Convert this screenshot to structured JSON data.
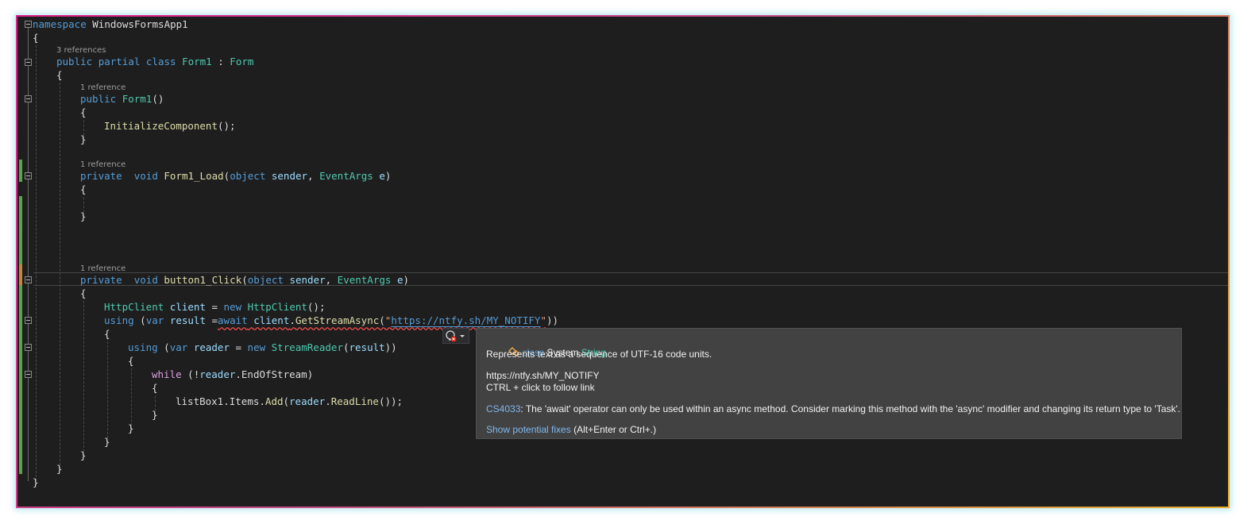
{
  "code": {
    "namespace_kw": "namespace",
    "namespace_name": "WindowsFormsApp1",
    "class_refs": "3 references",
    "class_public": "public",
    "class_partial": "partial",
    "class_kw": "class",
    "class_name": "Form1",
    "class_colon": " : ",
    "class_base": "Form",
    "ctor_refs": "1 reference",
    "ctor_public": "public",
    "ctor_name": "Form1",
    "ctor_parens": "()",
    "init_call": "InitializeComponent",
    "init_tail": "();",
    "load_refs": "1 reference",
    "load_private": "private",
    "load_void": "void",
    "load_name": "Form1_Load",
    "load_open": "(",
    "load_obj": "object",
    "load_sender": "sender",
    "load_comma": ", ",
    "load_eargs": "EventArgs",
    "load_e": "e",
    "load_close": ")",
    "click_refs": "1 reference",
    "click_private": "private",
    "click_void": "void",
    "click_name": "button1_Click",
    "click_open": "(",
    "click_obj": "object",
    "click_sender": "sender",
    "click_comma": ", ",
    "click_eargs": "EventArgs",
    "click_e": "e",
    "click_close": ")",
    "http_type": "HttpClient",
    "http_var": "client",
    "http_eq": " = ",
    "http_new": "new",
    "http_type2": "HttpClient",
    "http_tail": "();",
    "using1_kw": "using",
    "using1_open": " (",
    "using1_var": "var",
    "using1_name": "result",
    "using1_eq": " =",
    "using1_await": "await",
    "using1_client": "client",
    "using1_dot": ".",
    "using1_method": "GetStreamAsync",
    "using1_paren": "(",
    "using1_q1": "\"",
    "using1_url": "https://ntfy.sh/MY_NOTIFY",
    "using1_q2": "\"",
    "using1_close": "))",
    "using2_kw": "using",
    "using2_open": " (",
    "using2_var": "var",
    "using2_name": "reader",
    "using2_eq": " = ",
    "using2_new": "new",
    "using2_type": "StreamReader",
    "using2_paren": "(",
    "using2_arg": "result",
    "using2_close": "))",
    "while_kw": "while",
    "while_open": " (!",
    "while_reader": "reader",
    "while_dot": ".",
    "while_prop": "EndOfStream",
    "while_close": ")",
    "lb_name": "listBox1",
    "lb_dot1": ".",
    "lb_items": "Items",
    "lb_dot2": ".",
    "lb_add": "Add",
    "lb_paren": "(",
    "lb_reader": "reader",
    "lb_dot3": ".",
    "lb_readline": "ReadLine",
    "lb_tail": "());",
    "brace_open": "{",
    "brace_close": "}"
  },
  "tooltip": {
    "class_kw": "class",
    "class_ns": "System.",
    "class_name": "String",
    "description": "Represents text as a sequence of UTF-16 code units.",
    "url": "https://ntfy.sh/MY_NOTIFY",
    "follow_hint": "CTRL + click to follow link",
    "error_code": "CS4033",
    "error_text": ": The 'await' operator can only be used within an async method. Consider marking this method with the 'async' modifier and changing its return type to 'Task'.",
    "fix_link": "Show potential fixes",
    "fix_shortcut": " (Alt+Enter or Ctrl+.)"
  },
  "icons": [
    "collapse-icon",
    "lightbulb-error-icon",
    "dropdown-arrow-icon",
    "class-symbol-icon"
  ]
}
